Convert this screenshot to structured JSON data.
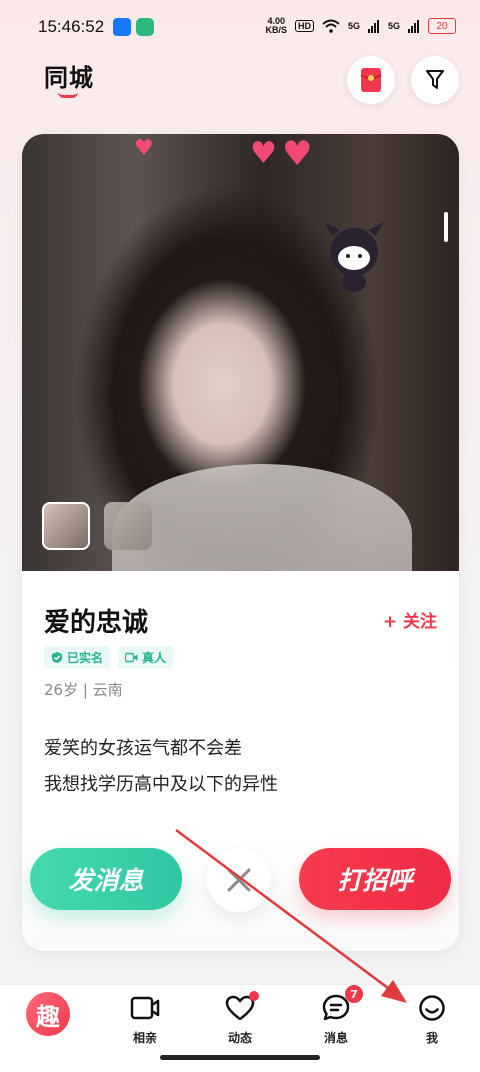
{
  "status_bar": {
    "time": "15:46:52",
    "net_speed_value": "4.00",
    "net_speed_unit": "KB/S",
    "hd_label": "HD",
    "sim1": "5G",
    "sim2": "5G",
    "battery": "20"
  },
  "header": {
    "title": "同城"
  },
  "profile": {
    "name": "爱的忠诚",
    "follow_label": "+ 关注",
    "badges": [
      "已实名",
      "真人"
    ],
    "meta": "26岁 | 云南",
    "bio_line1": "爱笑的女孩运气都不会差",
    "bio_line2": "我想找学历高中及以下的异性",
    "photo_count": 2
  },
  "actions": {
    "message_label": "发消息",
    "greet_label": "打招呼",
    "skip_icon": "close-icon"
  },
  "bottom_nav": {
    "logo_text": "趣",
    "items": [
      {
        "label": "相亲",
        "icon": "video-icon"
      },
      {
        "label": "动态",
        "icon": "heart-outline-icon",
        "has_dot": true
      },
      {
        "label": "消息",
        "icon": "chat-icon",
        "badge": "7"
      },
      {
        "label": "我",
        "icon": "smile-icon"
      }
    ]
  },
  "colors": {
    "accent_red": "#f0384a",
    "accent_teal": "#2ec7a2"
  }
}
